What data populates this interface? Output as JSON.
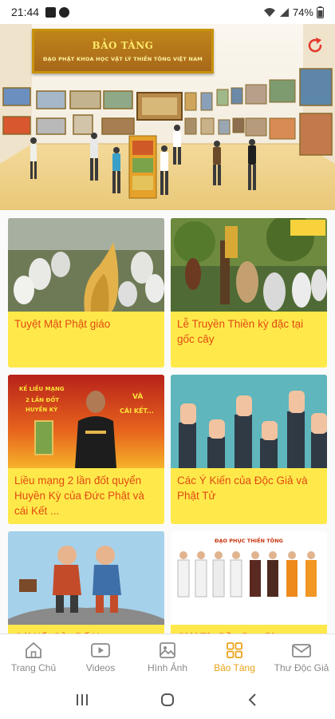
{
  "status_bar": {
    "time": "21:44",
    "battery": "74%"
  },
  "banner": {
    "title": "BẢO TÀNG",
    "subtitle": "ĐẠO PHẬT KHOA HỌC VẬT LÝ THIỀN TÔNG VIỆT NAM"
  },
  "cards": [
    {
      "title": "Tuyệt Mật Phật giáo"
    },
    {
      "title": "Lễ Truyền Thiền kỳ đặc tại gốc cây"
    },
    {
      "title": "Liều mạng 2 lần đốt quyển Huyền Kỳ của Đức Phật và cái Kết ..."
    },
    {
      "title": "Các Ý Kiến của Độc Giả và Phật Tử"
    },
    {
      "title": "Cái Kết Của Đố Kỵ"
    },
    {
      "title": "Giới Tín Đồ - Đạo Phục"
    }
  ],
  "thumb_text": {
    "card3_line1": "KẾ LIỀU MẠNG",
    "card3_line2": "2 LẦN ĐỐT",
    "card3_line3": "HUYỀN KỲ",
    "card3_line4": "VÀ",
    "card3_line5": "CÁI KẾT...",
    "card6_header": "ĐẠO PHỤC THIỀN TÔNG"
  },
  "nav": [
    {
      "label": "Trang Chủ",
      "icon": "home-icon"
    },
    {
      "label": "Videos",
      "icon": "video-icon"
    },
    {
      "label": "Hình Ảnh",
      "icon": "image-icon"
    },
    {
      "label": "Bảo Tàng",
      "icon": "museum-grid-icon",
      "active": true
    },
    {
      "label": "Thư Độc Giả",
      "icon": "mail-icon"
    }
  ],
  "colors": {
    "accent": "#eaa31a",
    "card_bg": "#ffe94a",
    "card_text": "#e14a12",
    "nav_inactive": "#8a8a8a"
  }
}
